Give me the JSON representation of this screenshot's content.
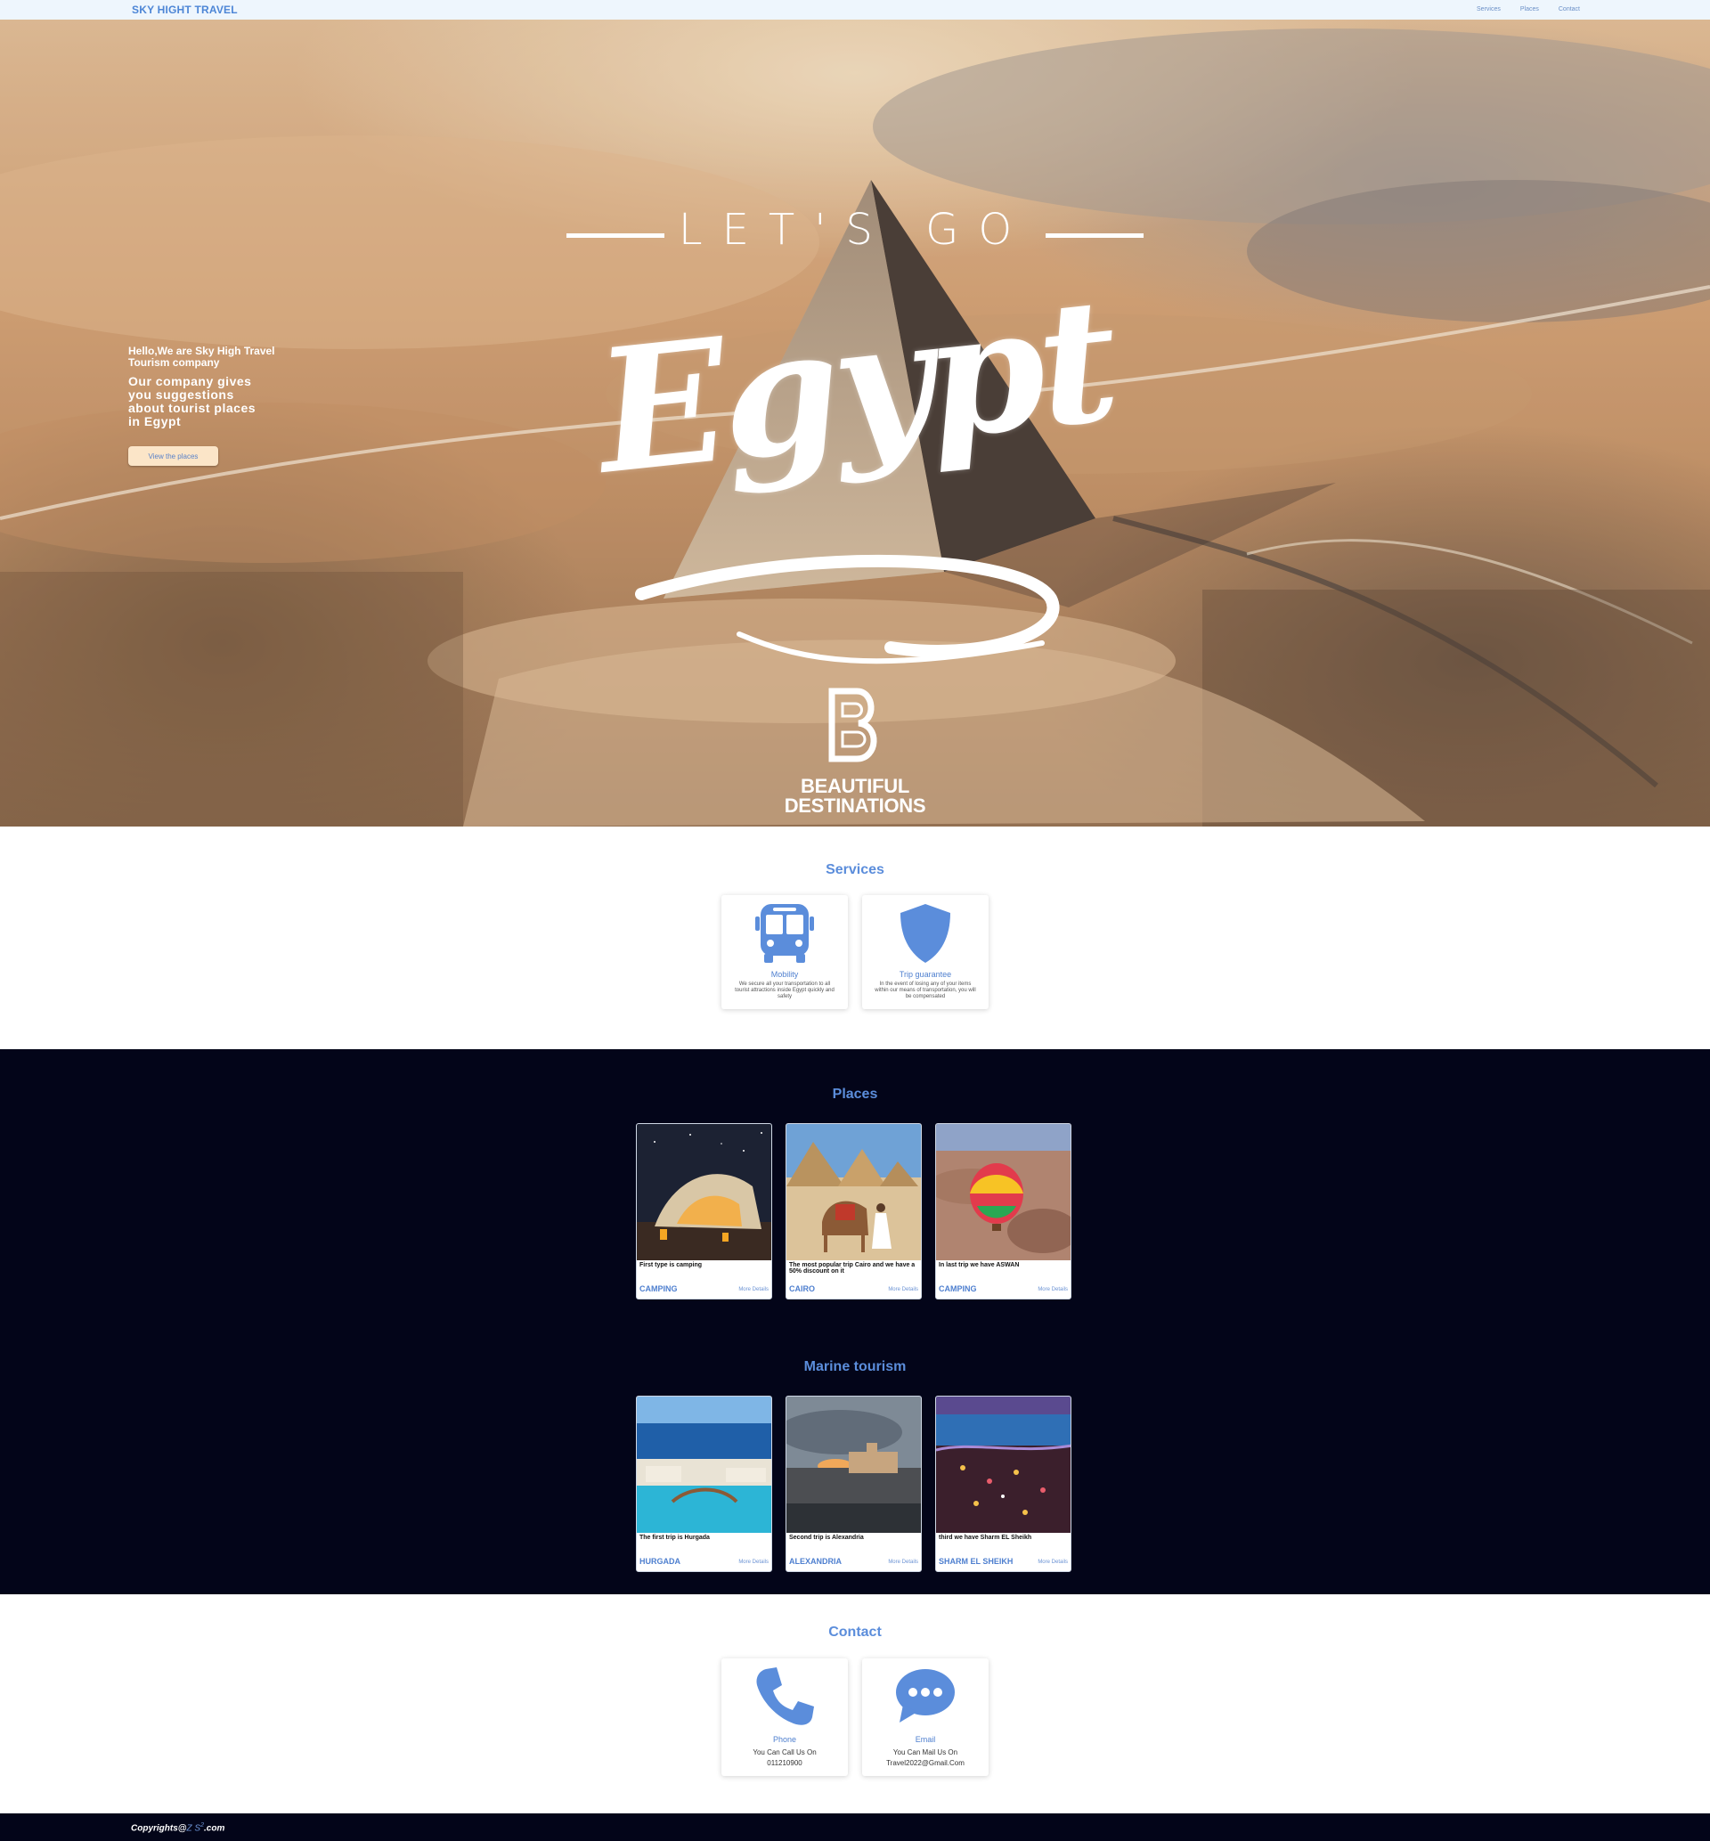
{
  "navbar": {
    "brand": "SKY HIGHT TRAVEL",
    "links": [
      "Services",
      "Places",
      "Contact"
    ]
  },
  "hero": {
    "hello": "Hello,We are Sky High Travel Tourism company",
    "description": "Our company gives you suggestions about tourist places in Egypt",
    "button_label": "View the places",
    "banner_top": "LET'S GO",
    "banner_main": "Egypt",
    "banner_brand_line1": "BEAUTIFUL",
    "banner_brand_line2": "DESTINATIONS"
  },
  "services": {
    "title": "Services",
    "items": [
      {
        "name": "Mobility",
        "icon": "bus-icon",
        "description": "We secure all your transportation to all tourist attractions inside Egypt quickly and safety"
      },
      {
        "name": "Trip guarantee",
        "icon": "shield-icon",
        "description": "In the event of losing any of your items within our means of transportation, you will be compensated"
      }
    ]
  },
  "places": {
    "title": "Places",
    "items": [
      {
        "caption": "First type is camping",
        "name": "CAMPING",
        "more": "More Details",
        "image": "desert-tent-night"
      },
      {
        "caption": "The most popular trip Cairo and we have a 50% discount on it",
        "name": "CAIRO",
        "more": "More Details",
        "image": "pyramids-camel"
      },
      {
        "caption": "In last trip we have ASWAN",
        "name": "CAMPING",
        "more": "More Details",
        "image": "hot-air-balloon"
      }
    ]
  },
  "marine": {
    "title": "Marine tourism",
    "items": [
      {
        "caption": "The first trip is Hurgada",
        "name": "HURGADA",
        "more": "More Details",
        "image": "resort-pool-sea"
      },
      {
        "caption": "Second trip is Alexandria",
        "name": "ALEXANDRIA",
        "more": "More Details",
        "image": "citadel-sunset"
      },
      {
        "caption": "third we have Sharm EL Sheikh",
        "name": "SHARM EL SHEIKH",
        "more": "More Details",
        "image": "coast-night-lights"
      }
    ]
  },
  "contact": {
    "title": "Contact",
    "items": [
      {
        "name": "Phone",
        "icon": "phone-icon",
        "line1": "You Can Call Us On",
        "line2": "011210900"
      },
      {
        "name": "Email",
        "icon": "chat-bubble-icon",
        "line1": "You Can Mail Us On",
        "line2": "Travel2022@Gmail.Com"
      }
    ]
  },
  "footer": {
    "prefix": "Copyrights@",
    "mark": "Z S",
    "sup": "2",
    "suffix": ".com"
  },
  "colors": {
    "accent": "#5b8ddb",
    "dark_bg": "#030519",
    "nav_bg": "#eef6fd",
    "hero_button": "#fbe5c8"
  }
}
